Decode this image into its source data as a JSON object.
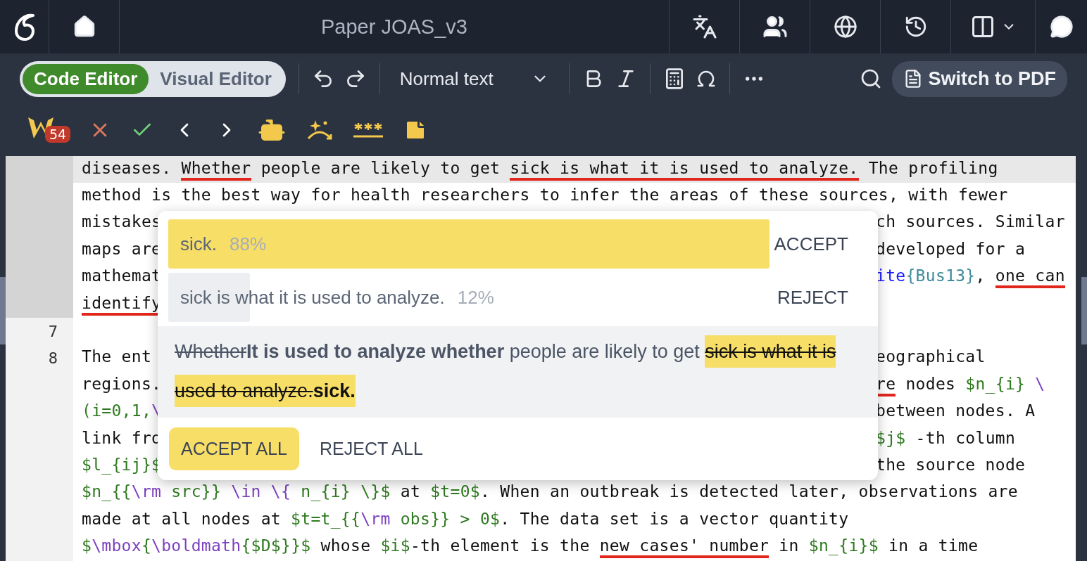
{
  "top_bar": {
    "title": "Paper JOAS_v3"
  },
  "toolbar": {
    "editor_modes": [
      {
        "label": "Code Editor",
        "selected": true
      },
      {
        "label": "Visual Editor",
        "selected": false
      }
    ],
    "text_style": "Normal text",
    "switch_button": "Switch to PDF"
  },
  "review_bar": {
    "badge": "54"
  },
  "editor": {
    "rows": [
      {
        "active": true,
        "highlighted": true,
        "full": [
          {
            "text": "diseases. ",
            "kind": "plain",
            "flagged": false
          },
          {
            "text": "Whether",
            "kind": "plain",
            "flagged": true
          },
          {
            "text": " people are likely to get ",
            "kind": "plain",
            "flagged": false
          },
          {
            "text": "sick is what it is used to analyze.",
            "kind": "plain",
            "flagged": true
          },
          {
            "text": " The profiling",
            "kind": "plain",
            "flagged": false
          }
        ]
      },
      {
        "active": true,
        "highlighted": false,
        "full": [
          {
            "text": "method is the best way for health researchers to infer the areas of these sources, with fewer",
            "kind": "plain",
            "flagged": false
          }
        ]
      },
      {
        "active": true,
        "highlighted": false,
        "left": [
          {
            "text": "mistakes",
            "kind": "plain",
            "flagged": false
          }
        ],
        "right": [
          {
            "text": "ch sources. Similar",
            "kind": "plain",
            "flagged": false
          }
        ]
      },
      {
        "active": true,
        "highlighted": false,
        "left": [
          {
            "text": "maps are",
            "kind": "plain",
            "flagged": false
          }
        ],
        "right": [
          {
            "text": "developed for a",
            "kind": "plain",
            "flagged": false
          }
        ]
      },
      {
        "active": true,
        "highlighted": false,
        "left": [
          {
            "text": "mathemat",
            "kind": "plain",
            "flagged": false
          }
        ],
        "right": [
          {
            "text": "ite",
            "kind": "cite",
            "flagged": false
          },
          {
            "text": "{Bus13}",
            "kind": "arg",
            "flagged": false
          },
          {
            "text": ", ",
            "kind": "plain",
            "flagged": false
          },
          {
            "text": "one can",
            "kind": "plain",
            "flagged": true
          }
        ]
      },
      {
        "active": true,
        "highlighted": false,
        "left": [
          {
            "text": "identify",
            "kind": "plain",
            "flagged": true
          }
        ],
        "right": []
      },
      {
        "active": false,
        "highlighted": false,
        "number": "7",
        "left": [],
        "right": []
      },
      {
        "active": false,
        "highlighted": false,
        "number": "8",
        "left": [
          {
            "text": "The ent",
            "kind": "plain",
            "flagged": false
          }
        ],
        "right": [
          {
            "text": "eographical",
            "kind": "plain",
            "flagged": false
          }
        ]
      },
      {
        "active": false,
        "highlighted": false,
        "left": [
          {
            "text": "regions.",
            "kind": "plain",
            "flagged": false
          }
        ],
        "right": [
          {
            "text": "re",
            "kind": "plain",
            "flagged": true
          },
          {
            "text": " nodes ",
            "kind": "plain",
            "flagged": false
          },
          {
            "text": "$n_{i}",
            "kind": "math",
            "flagged": false
          },
          {
            "text": " \\",
            "kind": "command",
            "flagged": false
          }
        ]
      },
      {
        "active": false,
        "highlighted": false,
        "left": [
          {
            "text": "(i=0,1,",
            "kind": "math",
            "flagged": false
          },
          {
            "text": "\\",
            "kind": "command",
            "flagged": false
          }
        ],
        "right": [
          {
            "text": "between nodes. A",
            "kind": "plain",
            "flagged": false
          }
        ]
      },
      {
        "active": false,
        "highlighted": false,
        "left": [
          {
            "text": "link fro",
            "kind": "plain",
            "flagged": false
          }
        ],
        "right": [
          {
            "text": "$j$",
            "kind": "math",
            "flagged": false
          },
          {
            "text": " -th column",
            "kind": "plain",
            "flagged": false
          }
        ]
      },
      {
        "active": false,
        "highlighted": false,
        "left": [
          {
            "text": "$l_{ij}$",
            "kind": "math",
            "flagged": false
          }
        ],
        "right": [
          {
            "text": "the source node",
            "kind": "plain",
            "flagged": false
          }
        ]
      },
      {
        "active": false,
        "highlighted": false,
        "full": [
          {
            "text": "$n_{{",
            "kind": "math",
            "flagged": false
          },
          {
            "text": "\\rm",
            "kind": "command",
            "flagged": false
          },
          {
            "text": " src}} ",
            "kind": "math",
            "flagged": false
          },
          {
            "text": "\\in \\{",
            "kind": "command",
            "flagged": false
          },
          {
            "text": " n_{i} \\}$",
            "kind": "math",
            "flagged": false
          },
          {
            "text": " at ",
            "kind": "plain",
            "flagged": false
          },
          {
            "text": "$t=0$",
            "kind": "math",
            "flagged": false
          },
          {
            "text": ". When an outbreak is detected later, observations are",
            "kind": "plain",
            "flagged": false
          }
        ]
      },
      {
        "active": false,
        "highlighted": false,
        "full": [
          {
            "text": "made at all nodes at ",
            "kind": "plain",
            "flagged": false
          },
          {
            "text": "$t=t_{{",
            "kind": "math",
            "flagged": false
          },
          {
            "text": "\\rm",
            "kind": "command",
            "flagged": false
          },
          {
            "text": " obs}} > 0$",
            "kind": "math",
            "flagged": false
          },
          {
            "text": ". The data set is a vector quantity",
            "kind": "plain",
            "flagged": false
          }
        ]
      },
      {
        "active": false,
        "highlighted": false,
        "full": [
          {
            "text": "$",
            "kind": "math",
            "flagged": false
          },
          {
            "text": "\\mbox",
            "kind": "command",
            "flagged": false
          },
          {
            "text": "{",
            "kind": "math",
            "flagged": false
          },
          {
            "text": "\\boldmath",
            "kind": "command",
            "flagged": false
          },
          {
            "text": "{$D$}}$",
            "kind": "math",
            "flagged": false
          },
          {
            "text": " whose ",
            "kind": "plain",
            "flagged": false
          },
          {
            "text": "$i$",
            "kind": "math",
            "flagged": false
          },
          {
            "text": "-th element is the ",
            "kind": "plain",
            "flagged": false
          },
          {
            "text": "new cases' number",
            "kind": "plain",
            "flagged": true
          },
          {
            "text": " in ",
            "kind": "plain",
            "flagged": false
          },
          {
            "text": "$n_{i}$",
            "kind": "math",
            "flagged": false
          },
          {
            "text": " in a time",
            "kind": "plain",
            "flagged": false
          }
        ]
      }
    ]
  },
  "suggestion_popup": {
    "options": [
      {
        "text": "sick.",
        "percent": "88%",
        "level": 0.88,
        "selected": true,
        "action": "ACCEPT"
      },
      {
        "text": "sick is what it is used to analyze.",
        "percent": "12%",
        "level": 0.12,
        "selected": false,
        "action": "REJECT"
      }
    ],
    "preview": [
      {
        "text": "Whether",
        "kind": "deleted",
        "highlight": false
      },
      {
        "text": "It is used to analyze whether",
        "kind": "inserted",
        "highlight": false
      },
      {
        "text": " people are likely to get ",
        "kind": "plain",
        "highlight": false
      },
      {
        "text": "sick is what it is used to analyze.",
        "kind": "deleted",
        "highlight": true
      },
      {
        "text": "sick.",
        "kind": "inserted",
        "highlight": true
      }
    ],
    "buttons": [
      {
        "label": "ACCEPT ALL",
        "primary": true
      },
      {
        "label": "REJECT ALL",
        "primary": false
      }
    ]
  }
}
